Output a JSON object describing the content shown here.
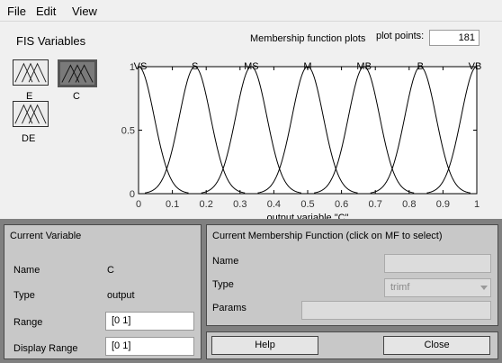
{
  "menu": {
    "file": "File",
    "edit": "Edit",
    "view": "View"
  },
  "fis": {
    "title": "FIS Variables",
    "variables": [
      {
        "label": "E",
        "selected": false
      },
      {
        "label": "C",
        "selected": true
      },
      {
        "label": "DE",
        "selected": false
      }
    ]
  },
  "plot": {
    "title": "Membership function plots",
    "plot_points_label": "plot points:",
    "plot_points_value": "181",
    "xlabel": "output variable \"C\"",
    "mf_names": [
      "VS",
      "S",
      "MS",
      "M",
      "MB",
      "B",
      "VB"
    ]
  },
  "chart_data": {
    "type": "line",
    "title": "Membership function plots",
    "xlabel": "output variable \"C\"",
    "ylabel": "",
    "xlim": [
      0,
      1
    ],
    "ylim": [
      0,
      1
    ],
    "x_ticks": [
      "0",
      "0.1",
      "0.2",
      "0.3",
      "0.4",
      "0.5",
      "0.6",
      "0.7",
      "0.8",
      "0.9",
      "1"
    ],
    "y_ticks": [
      "0",
      "0.5",
      "1"
    ],
    "series": [
      {
        "name": "VS",
        "center": 0,
        "width": 0.12
      },
      {
        "name": "S",
        "center": 0.1667,
        "width": 0.12
      },
      {
        "name": "MS",
        "center": 0.3333,
        "width": 0.12
      },
      {
        "name": "M",
        "center": 0.5,
        "width": 0.12
      },
      {
        "name": "MB",
        "center": 0.6667,
        "width": 0.12
      },
      {
        "name": "B",
        "center": 0.8333,
        "width": 0.12
      },
      {
        "name": "VB",
        "center": 1,
        "width": 0.12
      }
    ]
  },
  "current_variable": {
    "title": "Current Variable",
    "name_label": "Name",
    "name_value": "C",
    "type_label": "Type",
    "type_value": "output",
    "range_label": "Range",
    "range_value": "[0 1]",
    "display_range_label": "Display Range",
    "display_range_value": "[0 1]"
  },
  "current_mf": {
    "title": "Current Membership Function (click on MF to select)",
    "name_label": "Name",
    "name_value": "",
    "type_label": "Type",
    "type_value": "trimf",
    "params_label": "Params",
    "params_value": ""
  },
  "buttons": {
    "help": "Help",
    "close": "Close"
  }
}
